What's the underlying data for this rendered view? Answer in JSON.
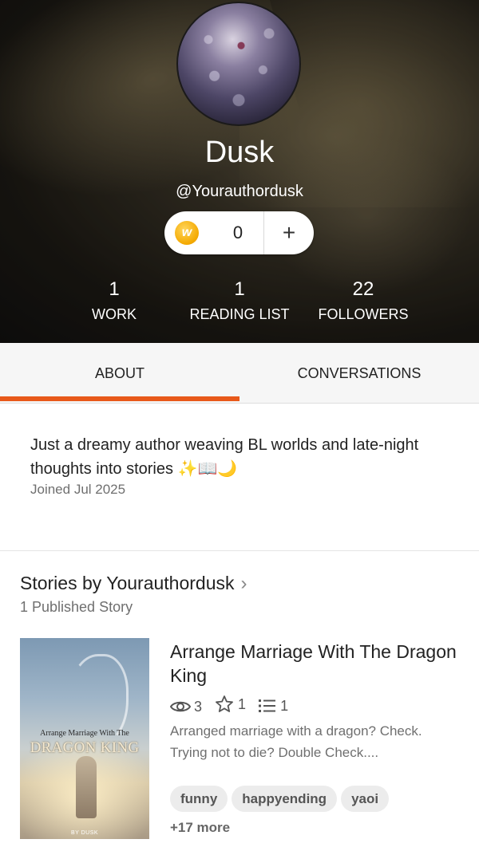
{
  "profile": {
    "name": "Dusk",
    "handle": "@Yourauthordusk",
    "coins": "0",
    "coin_plus": "+",
    "coin_icon_letter": "w",
    "stats": [
      {
        "value": "1",
        "label": "WORK"
      },
      {
        "value": "1",
        "label": "READING LIST"
      },
      {
        "value": "22",
        "label": "FOLLOWERS"
      }
    ]
  },
  "tabs": [
    {
      "label": "ABOUT",
      "active": true
    },
    {
      "label": "CONVERSATIONS",
      "active": false
    }
  ],
  "about": {
    "bio": "Just a dreamy author weaving BL worlds and late-night thoughts into stories ✨📖🌙",
    "joined": "Joined Jul 2025"
  },
  "stories": {
    "title": "Stories by Yourauthordusk",
    "chevron": "›",
    "count": "1 Published Story",
    "items": [
      {
        "title": "Arrange Marriage With The Dragon King",
        "cover_title_small": "Arrange Marriage With The",
        "cover_title_large": "DRAGON KING",
        "cover_byline": "BY DUSK",
        "reads": "3",
        "votes": "1",
        "parts": "1",
        "description_line1": "Arranged marriage with a dragon? Check.",
        "description_line2": "Trying not to die? Double Check....",
        "tags": [
          "funny",
          "happyending",
          "yaoi"
        ],
        "more_tags": "+17 more"
      }
    ]
  },
  "colors": {
    "accent": "#e8591a",
    "tag_bg": "#ececec",
    "coin": "#f4a900"
  },
  "icons": {
    "reads": "eye-icon",
    "votes": "star-icon",
    "parts": "list-icon",
    "coin": "coin-icon"
  }
}
